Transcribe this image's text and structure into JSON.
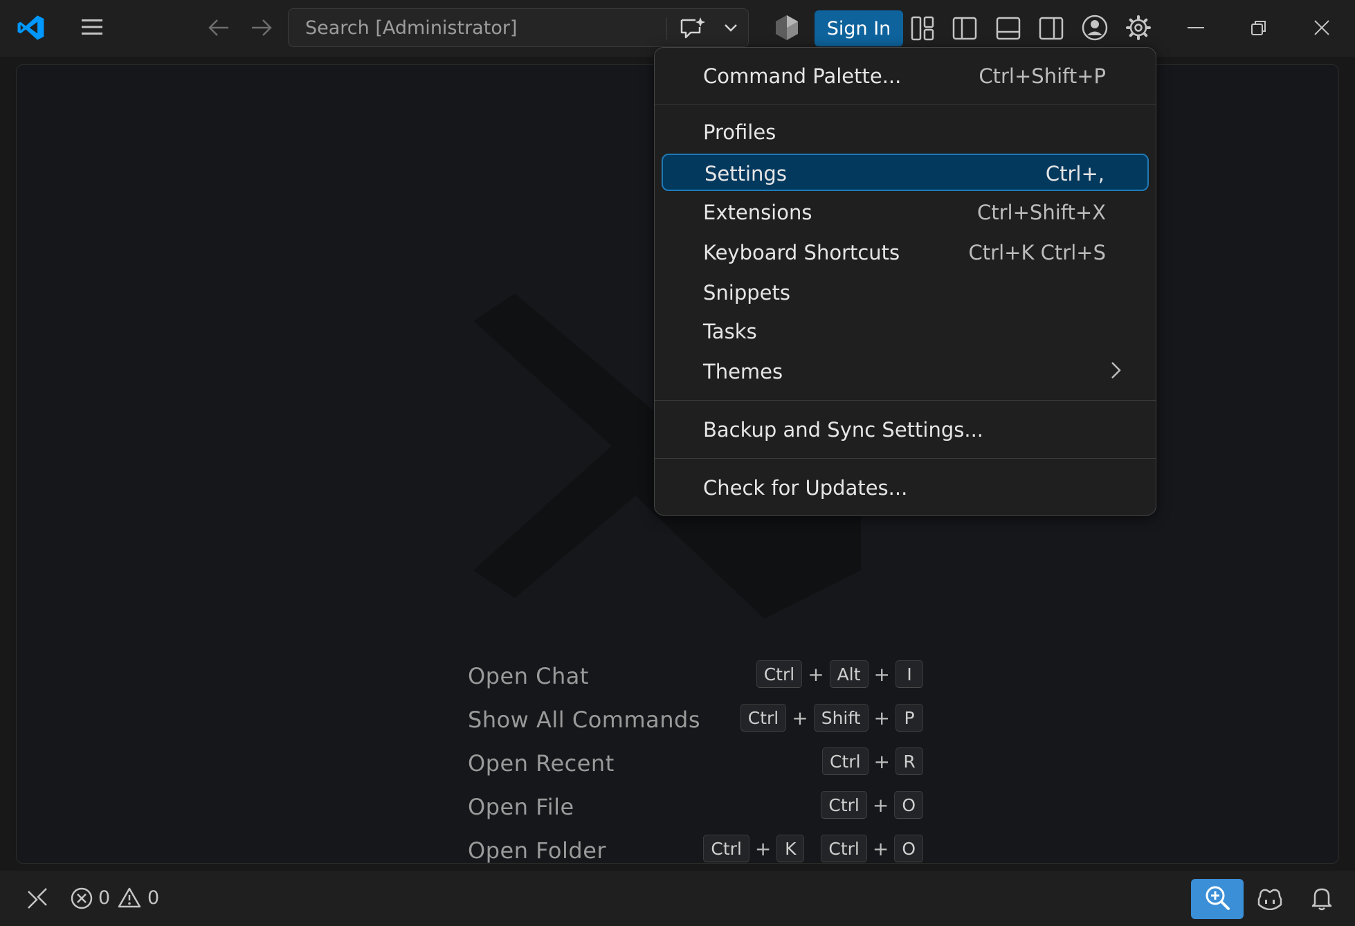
{
  "titlebar": {
    "search_placeholder": "Search [Administrator]",
    "sign_in_label": "Sign In"
  },
  "menu": {
    "items": [
      {
        "label": "Command Palette...",
        "shortcut": "Ctrl+Shift+P"
      },
      {
        "label": "Profiles",
        "shortcut": ""
      },
      {
        "label": "Settings",
        "shortcut": "Ctrl+,"
      },
      {
        "label": "Extensions",
        "shortcut": "Ctrl+Shift+X"
      },
      {
        "label": "Keyboard Shortcuts",
        "shortcut": "Ctrl+K Ctrl+S"
      },
      {
        "label": "Snippets",
        "shortcut": ""
      },
      {
        "label": "Tasks",
        "shortcut": ""
      },
      {
        "label": "Themes",
        "shortcut": ""
      },
      {
        "label": "Backup and Sync Settings...",
        "shortcut": ""
      },
      {
        "label": "Check for Updates...",
        "shortcut": ""
      }
    ],
    "selected": "Settings"
  },
  "watermark": {
    "shortcuts": [
      {
        "label": "Open Chat",
        "keys": [
          "Ctrl",
          "Alt",
          "I"
        ]
      },
      {
        "label": "Show All Commands",
        "keys": [
          "Ctrl",
          "Shift",
          "P"
        ]
      },
      {
        "label": "Open Recent",
        "keys": [
          "Ctrl",
          "R"
        ]
      },
      {
        "label": "Open File",
        "keys": [
          "Ctrl",
          "O"
        ]
      },
      {
        "label": "Open Folder",
        "keys": [
          "Ctrl",
          "K",
          "Ctrl",
          "O"
        ]
      }
    ]
  },
  "statusbar": {
    "errors": "0",
    "warnings": "0"
  },
  "colors": {
    "accent": "#0e639c",
    "selection_bg": "#04395e",
    "selection_border": "#1e7ab8",
    "logo_blue": "#0098ff",
    "zoom_button": "#3a8fd6"
  },
  "icons": {
    "logo": "vscode-logo-icon",
    "menu": "hamburger-menu-icon",
    "back": "arrow-left-icon",
    "forward": "arrow-right-icon",
    "copilot": "copilot-chat-icon",
    "dropdown": "chevron-down-icon",
    "gem": "gem-icon",
    "layout": "customize-layout-icon",
    "sidebar": "toggle-primary-sidebar-icon",
    "panel": "toggle-panel-icon",
    "secondary": "toggle-secondary-sidebar-icon",
    "account": "account-icon",
    "settings": "gear-icon",
    "minimize": "minimize-icon",
    "restore": "restore-icon",
    "close": "close-icon",
    "remote": "remote-icon",
    "error": "error-icon",
    "warning": "warning-icon",
    "zoom": "zoom-in-icon",
    "copilot_status": "copilot-icon",
    "bell": "bell-icon"
  }
}
